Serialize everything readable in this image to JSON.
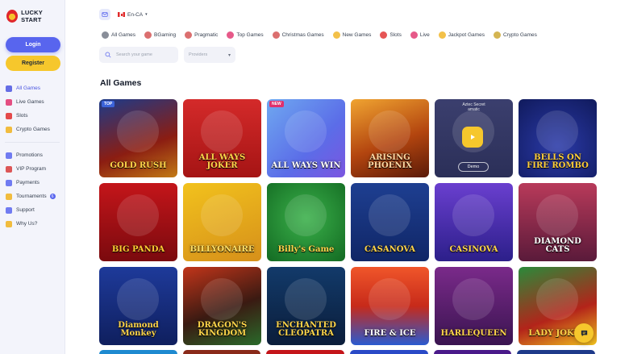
{
  "brand": {
    "name": "LUCKY START"
  },
  "auth": {
    "login_label": "Login",
    "register_label": "Register"
  },
  "sidebar": {
    "primary": [
      {
        "label": "All Games",
        "icon": "all-games-icon",
        "color": "#4a55e0"
      },
      {
        "label": "Live Games",
        "icon": "live-games-icon",
        "color": "#e0306c"
      },
      {
        "label": "Slots",
        "icon": "slots-icon",
        "color": "#e02b2b"
      },
      {
        "label": "Crypto Games",
        "icon": "crypto-icon",
        "color": "#f0b21c"
      }
    ],
    "secondary": [
      {
        "label": "Promotions",
        "icon": "promotions-icon",
        "color": "#5865ee"
      },
      {
        "label": "VIP Program",
        "icon": "vip-icon",
        "color": "#d73a3a"
      },
      {
        "label": "Payments",
        "icon": "payments-icon",
        "color": "#5865ee"
      },
      {
        "label": "Tournaments",
        "icon": "tournaments-icon",
        "color": "#f0b21c",
        "badge": "6"
      },
      {
        "label": "Support",
        "icon": "support-icon",
        "color": "#5865ee"
      },
      {
        "label": "Why Us?",
        "icon": "why-us-icon",
        "color": "#f0b21c"
      }
    ]
  },
  "topbar": {
    "locale": "En-CA"
  },
  "categories": [
    {
      "label": "All Games",
      "icon": "grid-icon",
      "color": "#6b7280"
    },
    {
      "label": "BGaming",
      "icon": "bgaming-icon",
      "color": "#d24b4b"
    },
    {
      "label": "Pragmatic",
      "icon": "pragmatic-icon",
      "color": "#d24b4b"
    },
    {
      "label": "Top Games",
      "icon": "top-games-icon",
      "color": "#e0306c"
    },
    {
      "label": "Christmas Games",
      "icon": "christmas-icon",
      "color": "#d24b4b"
    },
    {
      "label": "New Games",
      "icon": "new-games-icon",
      "color": "#f0b21c"
    },
    {
      "label": "Slots",
      "icon": "cherry-icon",
      "color": "#e02b2b"
    },
    {
      "label": "Live",
      "icon": "live-icon",
      "color": "#e0306c"
    },
    {
      "label": "Jackpot Games",
      "icon": "jackpot-icon",
      "color": "#f0b21c"
    },
    {
      "label": "Crypto Games",
      "icon": "crypto-icon",
      "color": "#c9a227"
    }
  ],
  "filters": {
    "search_placeholder": "Search your game",
    "providers_label": "Providers"
  },
  "section_title": "All Games",
  "games": [
    {
      "name": "GOLD RUSH",
      "tag": "TOP",
      "bg": "linear-gradient(160deg,#1c3b8a,#8b1d12 60%,#c27a15)",
      "color": "#ffd54a"
    },
    {
      "name": "ALL WAYS JOKER",
      "tag": "",
      "bg": "linear-gradient(180deg,#d42a2a,#a51414)",
      "color": "#ffd54a"
    },
    {
      "name": "ALL WAYS WIN",
      "tag": "NEW",
      "bg": "linear-gradient(135deg,#6fa8f0,#5b6de8 60%,#7b55e0)",
      "color": "#ffffff"
    },
    {
      "name": "ARISING PHOENIX",
      "tag": "",
      "bg": "linear-gradient(160deg,#f0a431,#b3450f 55%,#5a1a08)",
      "color": "#ffd7a1"
    },
    {
      "name": "",
      "tag": "",
      "bg": "linear-gradient(180deg,#3b3f6e,#2b2f58)",
      "color": "#ffffff",
      "hover_title": "Aztec Secret",
      "hover_provider": "amatic",
      "demo_label": "Demo"
    },
    {
      "name": "BELLS ON FIRE ROMBO",
      "tag": "",
      "bg": "radial-gradient(circle at 50% 60%,#2b3aa8,#101a5c)",
      "color": "#ffcf3a"
    },
    {
      "name": "BIG PANDA",
      "tag": "",
      "bg": "linear-gradient(180deg,#c4151a,#7a0a0e)",
      "color": "#ffcc33"
    },
    {
      "name": "BILLYONAIRE",
      "tag": "",
      "bg": "linear-gradient(160deg,#f2c21d,#d6901a)",
      "color": "#ffe066"
    },
    {
      "name": "Billy's Game",
      "tag": "",
      "bg": "radial-gradient(circle at 50% 45%,#3ab04a,#136a22)",
      "color": "#ffd54a"
    },
    {
      "name": "CASANOVA",
      "tag": "",
      "bg": "linear-gradient(180deg,#1e3f91,#102666)",
      "color": "#ffd54a"
    },
    {
      "name": "CASINOVA",
      "tag": "",
      "bg": "linear-gradient(180deg,#6a3fcf,#2c1f8a)",
      "color": "#ffd54a"
    },
    {
      "name": "DIAMOND CATS",
      "tag": "",
      "bg": "linear-gradient(180deg,#b83a5a,#5a1a3a)",
      "color": "#ffffff"
    },
    {
      "name": "Diamond Monkey",
      "tag": "",
      "bg": "linear-gradient(180deg,#1e3a9a,#0f1f5e)",
      "color": "#ffd54a"
    },
    {
      "name": "DRAGON'S KINGDOM",
      "tag": "",
      "bg": "linear-gradient(160deg,#c2351a,#3a1a12 55%,#2a6a2a)",
      "color": "#ffd54a"
    },
    {
      "name": "ENCHANTED CLEOPATRA",
      "tag": "",
      "bg": "linear-gradient(180deg,#123a6a,#0b1d3a)",
      "color": "#ffd54a"
    },
    {
      "name": "FIRE & ICE",
      "tag": "",
      "bg": "linear-gradient(180deg,#f0562a,#c72a1a 50%,#2a5ad0)",
      "color": "#ffffff"
    },
    {
      "name": "HARLEQUEEN",
      "tag": "",
      "bg": "linear-gradient(180deg,#7a2a8a,#3a1450)",
      "color": "#ffd54a"
    },
    {
      "name": "LADY JOKER",
      "tag": "",
      "bg": "linear-gradient(160deg,#2a8a3a,#b3241a 60%,#f0c21d)",
      "color": "#ffd54a"
    }
  ],
  "bottom_peek": [
    "#1e8ad0",
    "#8a2a1a",
    "#c4151a",
    "#2a4ac7",
    "#4a1a8a",
    "#1e3a8a"
  ]
}
